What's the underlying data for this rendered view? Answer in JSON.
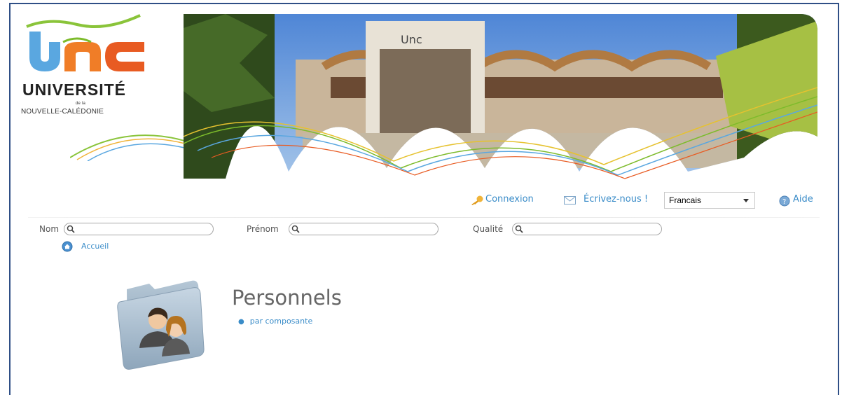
{
  "logo": {
    "line1": "UNIVERSITÉ",
    "line2": "NOUVELLE-CALÉDONIE",
    "small": "de la"
  },
  "toolbar": {
    "login_label": "Connexion",
    "contact_label": "Écrivez-nous !",
    "language_selected": "Francais",
    "help_label": "Aide"
  },
  "search": {
    "fields": [
      {
        "label": "Nom",
        "value": ""
      },
      {
        "label": "Prénom",
        "value": ""
      },
      {
        "label": "Qualité",
        "value": ""
      }
    ]
  },
  "nav": {
    "home_label": "Accueil"
  },
  "main": {
    "title": "Personnels",
    "links": [
      {
        "label": "par composante"
      }
    ]
  },
  "colors": {
    "link": "#3a8cc8",
    "frame_border": "#2f4f86",
    "logo_blue": "#3b8fd8",
    "logo_orange": "#f27a1c",
    "logo_green": "#7dbb2b"
  },
  "icons": [
    "key-icon",
    "mail-icon",
    "help-icon",
    "search-icon",
    "home-icon",
    "people-folder-icon"
  ]
}
